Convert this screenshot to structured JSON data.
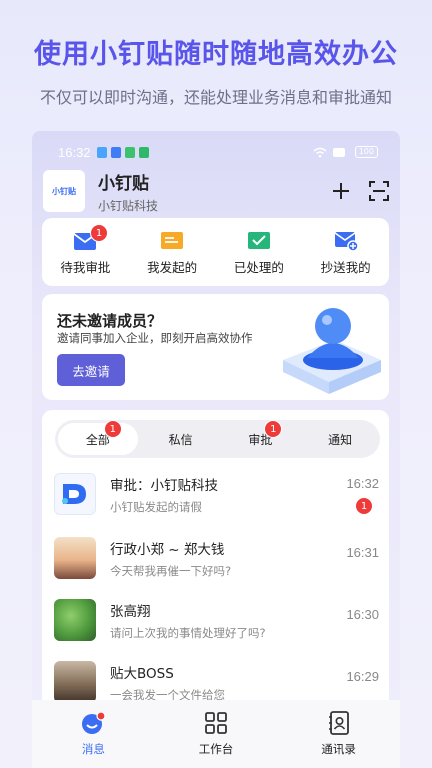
{
  "hero": {
    "title": "使用小钉贴随时随地高效办公",
    "subtitle": "不仅可以即时沟通，还能处理业务消息和审批通知"
  },
  "status_bar": {
    "time": "16:32",
    "battery": "100"
  },
  "app": {
    "logo_text": "小钉贴",
    "name": "小钉贴",
    "org": "小钉贴科技"
  },
  "quick_actions": [
    {
      "label": "待我审批",
      "badge": "1",
      "icon": "envelope-icon"
    },
    {
      "label": "我发起的",
      "icon": "send-icon"
    },
    {
      "label": "已处理的",
      "icon": "check-mail-icon"
    },
    {
      "label": "抄送我的",
      "icon": "cc-icon"
    }
  ],
  "invite": {
    "title": "还未邀请成员？",
    "desc": "邀请同事加入企业，即刻开启高效协作",
    "button": "去邀请"
  },
  "tabs": [
    {
      "label": "全部",
      "badge": "1",
      "active": true
    },
    {
      "label": "私信"
    },
    {
      "label": "审批",
      "badge": "1"
    },
    {
      "label": "通知"
    }
  ],
  "messages": [
    {
      "title": "审批：小钉贴科技",
      "sub": "小钉贴发起的请假",
      "time": "16:32",
      "badge": "1"
    },
    {
      "title": "行政小郑 ~ 郑大钱",
      "sub": "今天帮我再催一下好吗?",
      "time": "16:31"
    },
    {
      "title": "张高翔",
      "sub": "请问上次我的事情处理好了吗?",
      "time": "16:30"
    },
    {
      "title": "贴大BOSS",
      "sub": "一会我发一个文件给您",
      "time": "16:29"
    }
  ],
  "bottom_nav": [
    {
      "label": "消息",
      "icon": "chat-icon",
      "active": true
    },
    {
      "label": "工作台",
      "icon": "grid-icon"
    },
    {
      "label": "通讯录",
      "icon": "contacts-icon"
    }
  ],
  "colors": {
    "brand": "#5a55ea",
    "accent": "#3b6df3",
    "badge": "#ef3a3a"
  }
}
